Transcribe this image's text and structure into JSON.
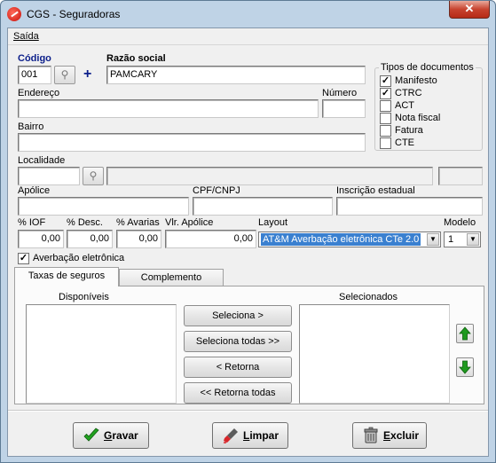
{
  "window": {
    "title": "CGS - Seguradoras",
    "close": "✕"
  },
  "menu": {
    "saida": "Saída"
  },
  "form": {
    "codigo": {
      "label": "Código",
      "value": "001"
    },
    "razao": {
      "label": "Razão social",
      "value": "PAMCARY"
    },
    "endereco": {
      "label": "Endereço",
      "value": ""
    },
    "numero": {
      "label": "Número",
      "value": ""
    },
    "bairro": {
      "label": "Bairro",
      "value": ""
    },
    "localidade": {
      "label": "Localidade",
      "value": ""
    },
    "apolice": {
      "label": "Apólice",
      "value": ""
    },
    "cpf": {
      "label": "CPF/CNPJ",
      "value": ""
    },
    "inscricao": {
      "label": "Inscrição estadual",
      "value": ""
    },
    "iof": {
      "label": "% IOF",
      "value": "0,00"
    },
    "desc": {
      "label": "% Desc.",
      "value": "0,00"
    },
    "avarias": {
      "label": "% Avarias",
      "value": "0,00"
    },
    "vlr_apolice": {
      "label": "Vlr. Apólice",
      "value": "0,00"
    },
    "layout": {
      "label": "Layout",
      "value": "AT&M Averbação eletrônica CTe 2.0"
    },
    "modelo": {
      "label": "Modelo",
      "value": "1"
    },
    "averbacao": {
      "label": "Averbação eletrônica",
      "checked": true
    }
  },
  "tipos": {
    "title": "Tipos de documentos",
    "items": [
      {
        "label": "Manifesto",
        "checked": true
      },
      {
        "label": "CTRC",
        "checked": true
      },
      {
        "label": "ACT",
        "checked": false
      },
      {
        "label": "Nota fiscal",
        "checked": false
      },
      {
        "label": "Fatura",
        "checked": false
      },
      {
        "label": "CTE",
        "checked": false
      }
    ]
  },
  "tabs": [
    {
      "label": "Taxas de seguros",
      "active": true
    },
    {
      "label": "Complemento",
      "active": false
    }
  ],
  "taxas": {
    "disponiveis": "Disponíveis",
    "selecionados": "Selecionados",
    "seleciona": "Seleciona >",
    "seleciona_todas": "Seleciona todas >>",
    "retorna": "< Retorna",
    "retorna_todas": "<< Retorna todas"
  },
  "actions": {
    "gravar_prefix": "",
    "gravar_u": "G",
    "gravar_rest": "ravar",
    "limpar_u": "L",
    "limpar_rest": "impar",
    "excluir_u": "E",
    "excluir_rest": "xcluir"
  },
  "colors": {
    "accent_up": "#1f9a1f",
    "accent_blue": "#0b1e8a",
    "title_bg": "#bfd3e6"
  }
}
